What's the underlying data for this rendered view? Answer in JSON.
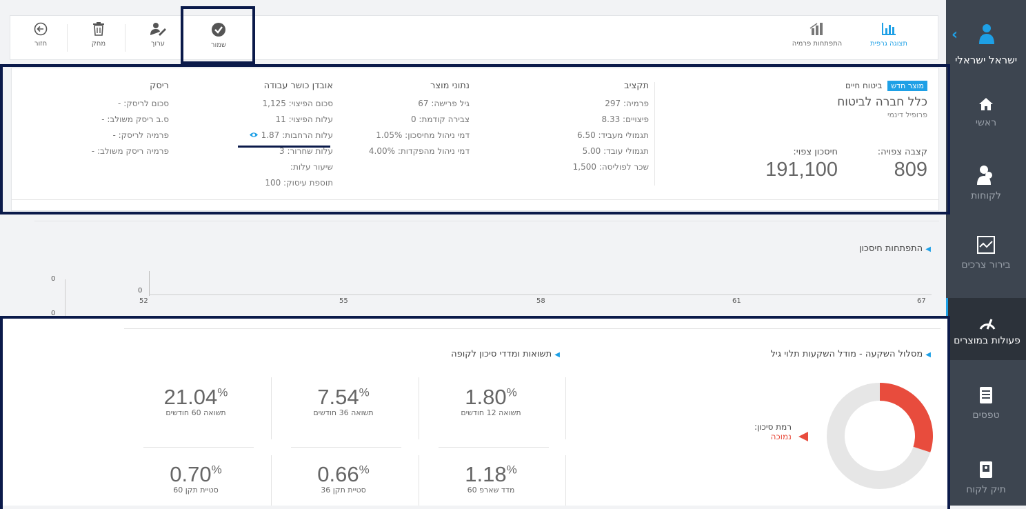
{
  "sidebar": {
    "user_name": "ישראל ישראלי",
    "items": [
      {
        "label": "ראשי",
        "icon": "home-icon"
      },
      {
        "label": "לקוחות",
        "icon": "clients-icon"
      },
      {
        "label": "בירור צרכים",
        "icon": "needs-chart-icon"
      },
      {
        "label": "פעולות במוצרים",
        "icon": "gauge-icon"
      },
      {
        "label": "טפסים",
        "icon": "forms-icon"
      },
      {
        "label": "תיק לקוח",
        "icon": "client-folder-icon"
      }
    ]
  },
  "toolbar": {
    "back": "חזור",
    "delete": "מחק",
    "edit": "ערוך",
    "save": "שמור",
    "premium_dev": "התפתחות פרמיה",
    "graph_view": "תצוגה גרפית"
  },
  "product": {
    "type": "ביטוח חיים",
    "new_badge": "מוצר חדש",
    "company": "כלל חברה לביטוח",
    "profile": "פרופיל דינמי",
    "pension_label": "קצבה צפויה:",
    "pension_value": "809",
    "savings_label": "חיסכון צפוי:",
    "savings_value": "191,100"
  },
  "budget": {
    "title": "תקציב",
    "rows": [
      "פרמיה: 297",
      "פיצויים: 8.33",
      "תגמולי מעביד: 6.50",
      "תגמולי עובד: 5.00",
      "שכר לפוליסה: 1,500"
    ]
  },
  "product_data": {
    "title": "נתוני מוצר",
    "rows": [
      "גיל פרישה: 67",
      "צבירה קודמת: 0",
      "דמי ניהול מחיסכון: 1.05%",
      "דמי ניהול מהפקדות: 4.00%"
    ]
  },
  "disability": {
    "title": "אובדן כושר עבודה",
    "rows": [
      "סכום הפיצוי: 1,125",
      "עלות הפיצוי: 11",
      "עלות הרחבות: 1.87",
      "עלות שחרור: 3",
      "שיעור עלות:",
      "תוספת עיסוק: 100"
    ]
  },
  "risk": {
    "title": "ריסק",
    "rows": [
      "סכום לריסק: -",
      "ס.ב ריסק משולב: -",
      "פרמיה לריסק: -",
      "פרמיה ריסק משולב: -"
    ]
  },
  "savings_chart": {
    "title": "התפתחות חיסכון",
    "left_y_tick_top": "0",
    "left_y_tick_bottom": "0",
    "inner_y_tick": "0",
    "x_ticks": [
      "52",
      "55",
      "58",
      "61",
      "67"
    ]
  },
  "investment": {
    "title": "מסלול השקעה - מודל השקעות תלוי גיל",
    "risk_label": "רמת סיכון:",
    "risk_value": "נמוכה",
    "donut_fraction": 0.3
  },
  "returns": {
    "title": "תשואות ומדדי סיכון לקופה",
    "metrics": [
      {
        "value": "1.80",
        "unit": "%",
        "label": "תשואה 12 חודשים"
      },
      {
        "value": "7.54",
        "unit": "%",
        "label": "תשואה 36 חודשים"
      },
      {
        "value": "21.04",
        "unit": "%",
        "label": "תשואה 60 חודשים"
      },
      {
        "value": "1.18",
        "unit": "%",
        "label": "מדד שארפ 60"
      },
      {
        "value": "0.66",
        "unit": "%",
        "label": "סטיית תקן 36"
      },
      {
        "value": "0.70",
        "unit": "%",
        "label": "סטיית תקן 60"
      }
    ]
  },
  "colors": {
    "accent": "#1ea0e6",
    "donut_red": "#e84c3d",
    "donut_grey": "#e6e6e6",
    "highlight_frame": "#0b1a4a"
  }
}
